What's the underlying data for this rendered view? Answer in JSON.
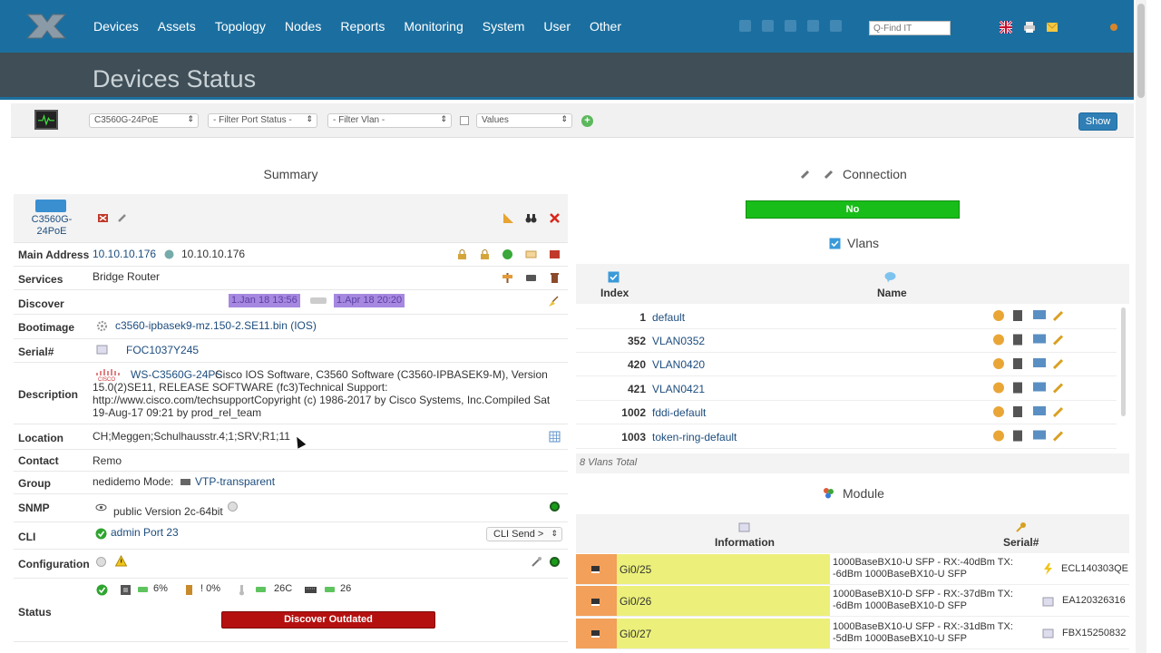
{
  "nav": {
    "items": [
      "Devices",
      "Assets",
      "Topology",
      "Nodes",
      "Reports",
      "Monitoring",
      "System",
      "User",
      "Other"
    ],
    "search_placeholder": "Q-Find IT"
  },
  "page": {
    "title": "Devices Status"
  },
  "filters": {
    "device": "C3560G-24PoE",
    "port_status": "- Filter Port Status -",
    "vlan": "- Filter Vlan -",
    "values": "Values",
    "show_label": "Show"
  },
  "summary": {
    "heading": "Summary",
    "device_name": "C3560G-24PoE",
    "main_address_label": "Main Address",
    "main_address": "10.10.10.176",
    "main_address_resolved": "10.10.10.176",
    "services_label": "Services",
    "services": "Bridge Router",
    "discover_label": "Discover",
    "discover_first": "1.Jan 18 13:56",
    "discover_last": "1.Apr 18 20:20",
    "bootimage_label": "Bootimage",
    "bootimage": "c3560-ipbasek9-mz.150-2.SE11.bin (IOS)",
    "serial_label": "Serial#",
    "serial": "FOC1037Y245",
    "description_label": "Description",
    "description_link": "WS-C3560G-24PS",
    "description": "Cisco IOS Software, C3560 Software (C3560-IPBASEK9-M), Version 15.0(2)SE11, RELEASE SOFTWARE (fc3)Technical Support: http://www.cisco.com/techsupportCopyright (c) 1986-2017 by Cisco Systems, Inc.Compiled Sat 19-Aug-17 09:21 by prod_rel_team",
    "location_label": "Location",
    "location": "CH;Meggen;Schulhausstr.4;1;SRV;R1;11",
    "contact_label": "Contact",
    "contact": "Remo",
    "group_label": "Group",
    "group": "nedidemo Mode:",
    "group_mode": "VTP-transparent",
    "snmp_label": "SNMP",
    "snmp": "public Version 2c-64bit",
    "cli_label": "CLI",
    "cli": "admin Port 23",
    "cli_send": "CLI Send >",
    "config_label": "Configuration",
    "status_label": "Status",
    "status_cpu": "6%",
    "status_mem": "! 0%",
    "status_temp": "26C",
    "status_ports": "26",
    "discover_outdated": "Discover Outdated"
  },
  "connection": {
    "heading": "Connection",
    "status": "No"
  },
  "vlans": {
    "heading": "Vlans",
    "col_index": "Index",
    "col_name": "Name",
    "rows": [
      {
        "index": "1",
        "name": "default"
      },
      {
        "index": "352",
        "name": "VLAN0352"
      },
      {
        "index": "420",
        "name": "VLAN0420"
      },
      {
        "index": "421",
        "name": "VLAN0421"
      },
      {
        "index": "1002",
        "name": "fddi-default"
      },
      {
        "index": "1003",
        "name": "token-ring-default"
      }
    ],
    "total": "8 Vlans Total"
  },
  "module": {
    "heading": "Module",
    "col_info": "Information",
    "col_serial": "Serial#",
    "rows": [
      {
        "port": "Gi0/25",
        "desc": "1000BaseBX10-U SFP - RX:-40dBm TX: -6dBm 1000BaseBX10-U SFP",
        "serial": "ECL140303QE"
      },
      {
        "port": "Gi0/26",
        "desc": "1000BaseBX10-D SFP - RX:-37dBm TX: -6dBm 1000BaseBX10-D SFP",
        "serial": "EA120326316"
      },
      {
        "port": "Gi0/27",
        "desc": "1000BaseBX10-U SFP - RX:-31dBm TX: -5dBm 1000BaseBX10-U SFP",
        "serial": "FBX15250832"
      }
    ]
  },
  "colors": {
    "nav": "#1b6fa0",
    "title_band": "#3f4e57",
    "connection_no": "#19bd19",
    "discover_outdated": "#b51010",
    "date_pill": "#a688e0"
  }
}
